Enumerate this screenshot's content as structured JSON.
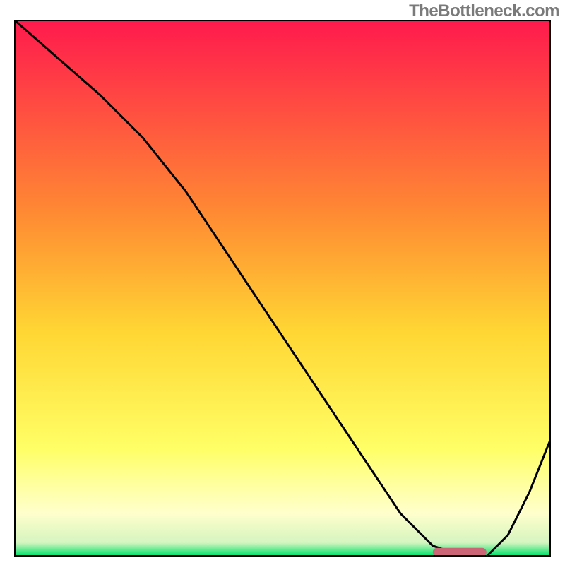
{
  "watermark": "TheBottleneck.com",
  "chart_data": {
    "type": "line",
    "title": "",
    "xlabel": "",
    "ylabel": "",
    "xlim": [
      0,
      100
    ],
    "ylim": [
      0,
      100
    ],
    "grid": false,
    "background_gradient": [
      {
        "stop": 0.0,
        "color": "#ff1a4d"
      },
      {
        "stop": 0.36,
        "color": "#ff8a33"
      },
      {
        "stop": 0.58,
        "color": "#ffd633"
      },
      {
        "stop": 0.8,
        "color": "#ffff66"
      },
      {
        "stop": 0.92,
        "color": "#ffffcc"
      },
      {
        "stop": 0.975,
        "color": "#d6f5c0"
      },
      {
        "stop": 1.0,
        "color": "#00e36b"
      }
    ],
    "series": [
      {
        "name": "bottleneck-curve",
        "color": "#000000",
        "x": [
          0,
          8,
          16,
          24,
          32,
          40,
          48,
          56,
          64,
          72,
          78,
          84,
          88,
          92,
          96,
          100
        ],
        "y": [
          100,
          93,
          86,
          78,
          68,
          56,
          44,
          32,
          20,
          8,
          2,
          0,
          0,
          4,
          12,
          22
        ]
      }
    ],
    "marker": {
      "name": "optimal-range",
      "shape": "rounded-rect",
      "color": "#cc6677",
      "x_range": [
        78,
        88
      ],
      "y": 0,
      "height_pct": 1.6
    },
    "frame": {
      "show": true,
      "color": "#000000",
      "width": 2
    }
  }
}
